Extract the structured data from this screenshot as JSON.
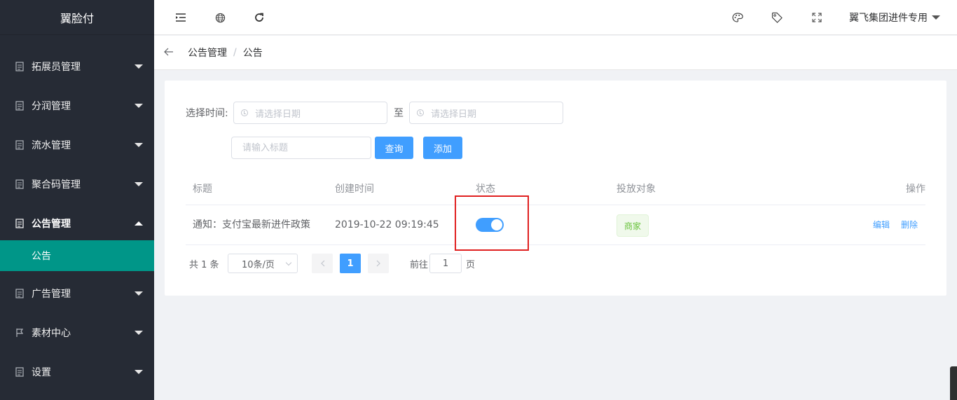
{
  "sidebar": {
    "brand": "翼脸付",
    "items": [
      {
        "label": "拓展员管理",
        "icon": "doc-icon"
      },
      {
        "label": "分润管理",
        "icon": "doc-icon"
      },
      {
        "label": "流水管理",
        "icon": "doc-icon"
      },
      {
        "label": "聚合码管理",
        "icon": "doc-icon"
      },
      {
        "label": "公告管理",
        "icon": "doc-icon",
        "open": true,
        "children": [
          {
            "label": "公告",
            "active": true
          }
        ]
      },
      {
        "label": "广告管理",
        "icon": "doc-icon"
      },
      {
        "label": "素材中心",
        "icon": "flag-icon"
      },
      {
        "label": "设置",
        "icon": "doc-icon"
      }
    ],
    "active_color": "#009688",
    "background": "#262b35"
  },
  "header": {
    "icons_left": [
      "menu-fold-icon",
      "globe-icon",
      "refresh-icon"
    ],
    "icons_right": [
      "palette-icon",
      "tag-icon",
      "fullscreen-icon"
    ],
    "user": "翼飞集团进件专用"
  },
  "breadcrumb": {
    "back_icon": "arrow-left-icon",
    "items": [
      "公告管理",
      "公告"
    ],
    "separator": "/"
  },
  "filters": {
    "time_label": "选择时间:",
    "start_placeholder": "请选择日期",
    "to_label": "至",
    "end_placeholder": "请选择日期",
    "title_placeholder": "请输入标题",
    "query_button": "查询",
    "add_button": "添加"
  },
  "table": {
    "columns": [
      "标题",
      "创建时间",
      "状态",
      "投放对象",
      "操作"
    ],
    "rows": [
      {
        "title": "通知：支付宝最新进件政策",
        "created": "2019-10-22 09:19:45",
        "status_on": true,
        "target": "商家",
        "actions": [
          "编辑",
          "删除"
        ]
      }
    ]
  },
  "pagination": {
    "total_text": "共 1 条",
    "page_size": "10条/页",
    "current_page": "1",
    "goto_label": "前往",
    "goto_value": "1",
    "page_suffix": "页"
  },
  "colors": {
    "primary": "#409eff",
    "highlight_box": "#e02020",
    "tag_text": "#67c23a"
  }
}
